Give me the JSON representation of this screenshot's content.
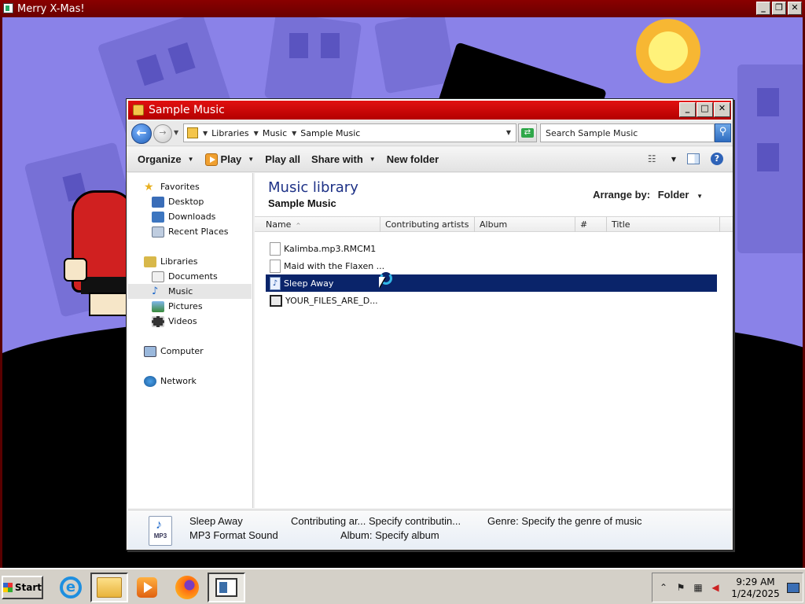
{
  "outer_window": {
    "title": "Merry X-Mas!",
    "min": "_",
    "restore": "❐",
    "close": "✕"
  },
  "explorer": {
    "title": "Sample Music",
    "min": "_",
    "max": "□",
    "close": "✕",
    "address": {
      "crumbs": [
        "Libraries",
        "Music",
        "Sample Music"
      ]
    },
    "search": {
      "placeholder": "Search Sample Music"
    },
    "toolbar": {
      "organize": "Organize",
      "play": "Play",
      "play_all": "Play all",
      "share_with": "Share with",
      "new_folder": "New folder"
    },
    "nav": {
      "favorites": "Favorites",
      "desktop": "Desktop",
      "downloads": "Downloads",
      "recent_places": "Recent Places",
      "libraries": "Libraries",
      "documents": "Documents",
      "music": "Music",
      "pictures": "Pictures",
      "videos": "Videos",
      "computer": "Computer",
      "network": "Network"
    },
    "library": {
      "title": "Music library",
      "subtitle": "Sample Music",
      "arrange_label": "Arrange by:",
      "arrange_value": "Folder"
    },
    "columns": [
      "Name",
      "Contributing artists",
      "Album",
      "#",
      "Title"
    ],
    "files": [
      {
        "name": "Kalimba.mp3.RMCM1",
        "icon": "generic-file-icon"
      },
      {
        "name": "Maid with the Flaxen ...",
        "icon": "generic-file-icon"
      },
      {
        "name": "Sleep Away",
        "icon": "music-file-icon",
        "selected": true
      },
      {
        "name": "YOUR_FILES_ARE_D...",
        "icon": "web-file-icon"
      }
    ],
    "details": {
      "name": "Sleep Away",
      "type": "MP3 Format Sound",
      "icon_label": "MP3",
      "artists": "Contributing ar... Specify contributin...",
      "album": "Album: Specify album",
      "genre": "Genre: Specify the genre of music"
    }
  },
  "taskbar": {
    "start": "Start",
    "time": "9:29 AM",
    "date": "1/24/2025"
  }
}
